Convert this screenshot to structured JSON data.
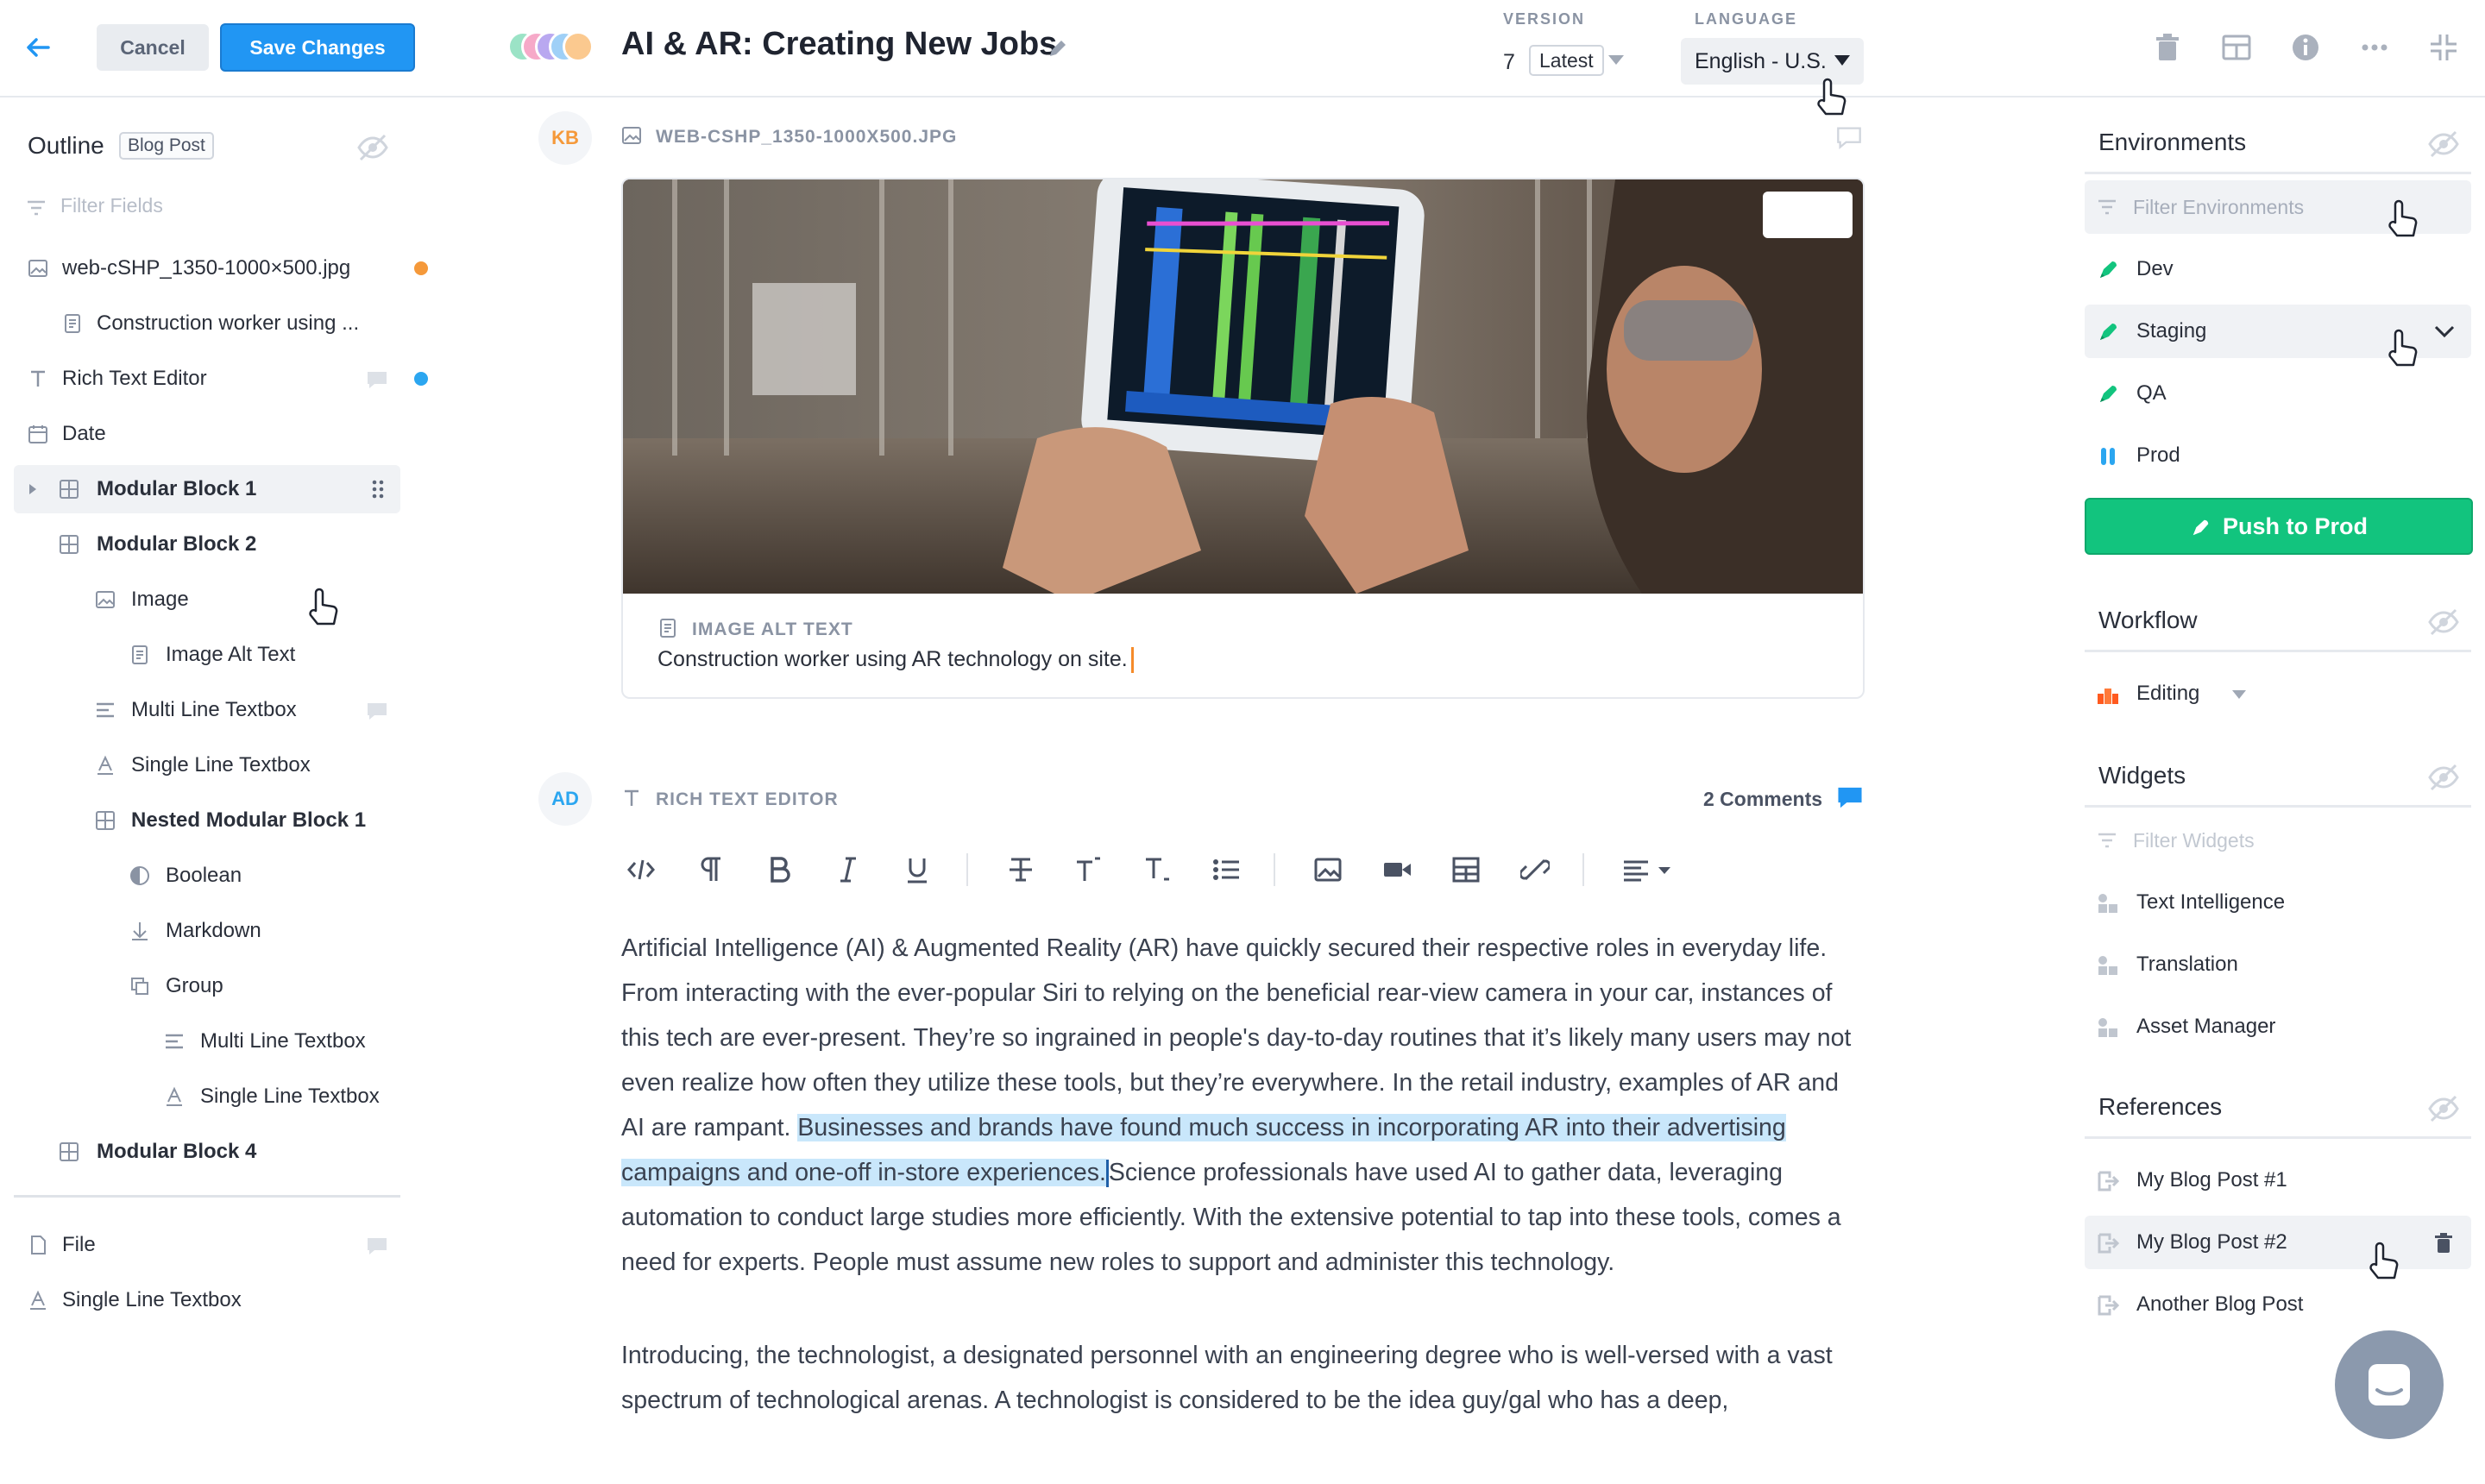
{
  "toolbar": {
    "cancel": "Cancel",
    "save": "Save Changes"
  },
  "document": {
    "title": "AI & AR: Creating New Jobs"
  },
  "version": {
    "label": "VERSION",
    "number": "7",
    "selected": "Latest"
  },
  "language": {
    "label": "LANGUAGE",
    "selected": "English - U.S."
  },
  "outline": {
    "title": "Outline",
    "tag": "Blog Post",
    "filter_placeholder": "Filter Fields",
    "items": [
      {
        "label": "web-cSHP_1350-1000×500.jpg",
        "icon": "image-icon"
      },
      {
        "label": "Construction worker using ...",
        "icon": "document-icon"
      },
      {
        "label": "Rich Text Editor",
        "icon": "text-icon"
      },
      {
        "label": "Date",
        "icon": "calendar-icon"
      },
      {
        "label": "Modular Block 1",
        "icon": "grid-icon"
      },
      {
        "label": "Modular Block 2",
        "icon": "grid-icon"
      },
      {
        "label": "Image",
        "icon": "image-icon"
      },
      {
        "label": "Image Alt Text",
        "icon": "document-icon"
      },
      {
        "label": "Multi Line Textbox",
        "icon": "multiline-icon"
      },
      {
        "label": "Single Line Textbox",
        "icon": "single-line-icon"
      },
      {
        "label": "Nested Modular Block 1",
        "icon": "grid-icon"
      },
      {
        "label": "Boolean",
        "icon": "boolean-icon"
      },
      {
        "label": "Markdown",
        "icon": "markdown-icon"
      },
      {
        "label": "Group",
        "icon": "group-icon"
      },
      {
        "label": "Multi Line Textbox",
        "icon": "multiline-icon"
      },
      {
        "label": "Single Line Textbox",
        "icon": "single-line-icon"
      },
      {
        "label": "Modular Block 4",
        "icon": "grid-icon"
      },
      {
        "label": "File",
        "icon": "file-icon"
      },
      {
        "label": "Single Line Textbox",
        "icon": "single-line-icon"
      }
    ]
  },
  "image_field": {
    "avatar": "KB",
    "filename": "WEB-CSHP_1350-1000X500.JPG",
    "alt_label": "IMAGE ALT TEXT",
    "alt_value": "Construction worker using AR technology on site."
  },
  "rte_field": {
    "avatar": "AD",
    "label": "RICH TEXT EDITOR",
    "comments": "2 Comments",
    "p1_before": "Artificial Intelligence (AI) & Augmented Reality (AR) have quickly secured their respective roles in everyday life. From interacting with the ever-popular Siri to relying on the beneficial rear-view camera in your car, instances of this tech are ever-present. They’re so ingrained in people's day-to-day routines that it’s likely many users may not even realize how often they utilize these tools, but they’re everywhere. In the retail industry, examples of AR and AI are rampant. ",
    "p1_highlight": "Businesses and brands have found much success in incorporating AR into their advertising campaigns and one-off in-store experiences.",
    "p1_after": "Science professionals have used AI to gather data, leveraging automation to conduct large studies more efficiently. With the extensive potential to tap into these tools, comes a need for experts. People must assume new roles to support and administer this technology.",
    "p2": "Introducing, the technologist, a designated personnel with an engineering degree who is well-versed with a vast spectrum of technological arenas. A technologist is considered to be the idea guy/gal who has a deep,"
  },
  "environments": {
    "title": "Environments",
    "filter_placeholder": "Filter Environments",
    "items": [
      "Dev",
      "Staging",
      "QA",
      "Prod"
    ],
    "push_label": "Push to Prod"
  },
  "workflow": {
    "title": "Workflow",
    "status": "Editing"
  },
  "widgets": {
    "title": "Widgets",
    "filter_placeholder": "Filter Widgets",
    "items": [
      "Text Intelligence",
      "Translation",
      "Asset Manager"
    ]
  },
  "references": {
    "title": "References",
    "items": [
      "My Blog Post #1",
      "My Blog Post #2",
      "Another Blog Post"
    ]
  },
  "colors": {
    "accent": "#2196f3",
    "push": "#12c47e",
    "highlight": "#c9e7fb",
    "orange_dot": "#f5993a",
    "blue_dot": "#2ba6f0"
  }
}
